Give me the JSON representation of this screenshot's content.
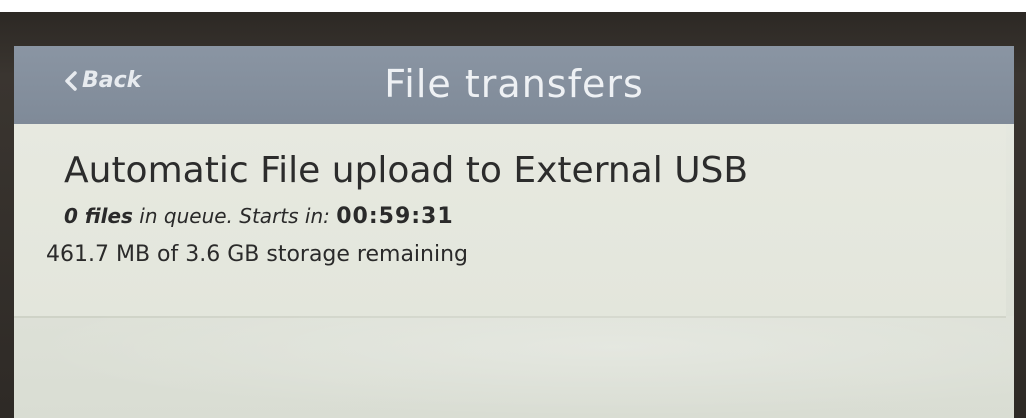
{
  "header": {
    "back_label": "Back",
    "title": "File transfers"
  },
  "upload": {
    "title": "Automatic File upload to External USB",
    "files_count": "0 files",
    "queue_text": " in queue. Starts in: ",
    "countdown": "00:59:31",
    "storage_text": "461.7 MB of 3.6 GB storage remaining"
  },
  "colors": {
    "header_bg": "#8a95a3",
    "panel_bg": "#e7e9e0",
    "text": "#2c2c2c"
  },
  "icons": {
    "back": "chevron-left-icon"
  }
}
